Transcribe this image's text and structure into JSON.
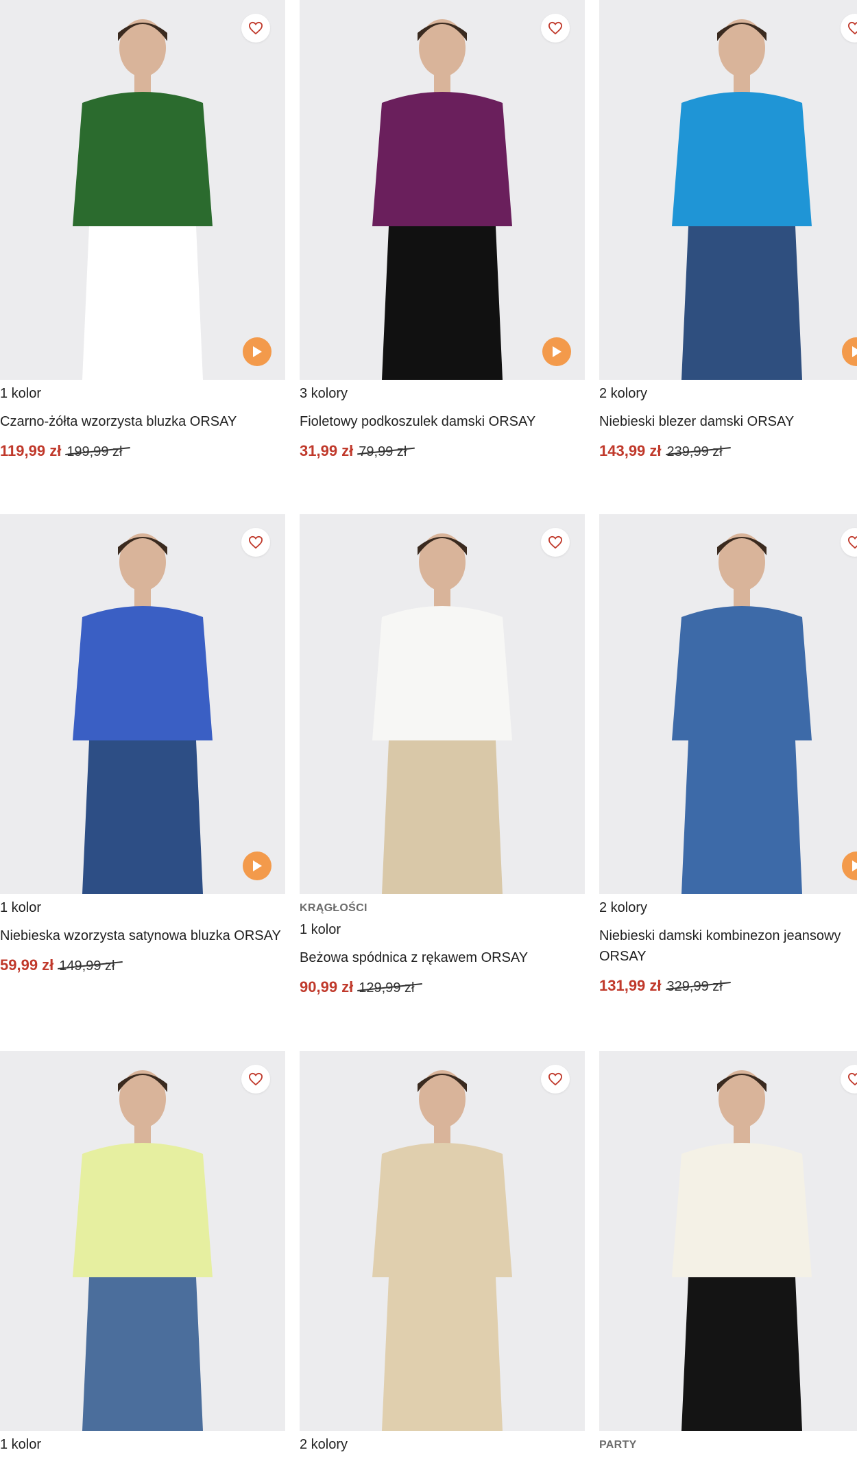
{
  "colors": {
    "price_sale": "#c0392b",
    "play_button": "#f39a4b",
    "heart_icon": "#c0392b",
    "photo_bg": "#ececee"
  },
  "products": [
    {
      "badge": "",
      "color_count": "1 kolor",
      "name": "Czarno-żółta wzorzysta bluzka ORSAY",
      "price_now": "119,99 zł",
      "price_old": "199,99 zł",
      "has_video": true,
      "garment_colors": [
        "#2b6b2e",
        "#ffffff"
      ]
    },
    {
      "badge": "",
      "color_count": "3 kolory",
      "name": "Fioletowy podkoszulek damski ORSAY",
      "price_now": "31,99 zł",
      "price_old": "79,99 zł",
      "has_video": true,
      "garment_colors": [
        "#6a1f5c",
        "#111111"
      ]
    },
    {
      "badge": "",
      "color_count": "2 kolory",
      "name": "Niebieski blezer damski ORSAY",
      "price_now": "143,99 zł",
      "price_old": "239,99 zł",
      "has_video": true,
      "garment_colors": [
        "#1f95d6",
        "#2f4f7f"
      ]
    },
    {
      "badge": "",
      "color_count": "1 kolor",
      "name": "Niebieska wzorzysta satynowa bluzka ORSAY",
      "price_now": "59,99 zł",
      "price_old": "149,99 zł",
      "has_video": true,
      "garment_colors": [
        "#3a5fc4",
        "#2d4e85"
      ]
    },
    {
      "badge": "KRĄGŁOŚCI",
      "color_count": "1 kolor",
      "name": "Beżowa spódnica z rękawem ORSAY",
      "price_now": "90,99 zł",
      "price_old": "129,99 zł",
      "has_video": false,
      "garment_colors": [
        "#f7f7f5",
        "#d9c8a8"
      ]
    },
    {
      "badge": "",
      "color_count": "2 kolory",
      "name": "Niebieski damski kombinezon jeansowy ORSAY",
      "price_now": "131,99 zł",
      "price_old": "329,99 zł",
      "has_video": true,
      "garment_colors": [
        "#3d6aa8",
        "#3d6aa8"
      ]
    },
    {
      "badge": "",
      "color_count": "1 kolor",
      "name": "",
      "price_now": "",
      "price_old": "",
      "has_video": false,
      "garment_colors": [
        "#e6efa0",
        "#4b6e9c"
      ]
    },
    {
      "badge": "",
      "color_count": "2 kolory",
      "name": "",
      "price_now": "",
      "price_old": "",
      "has_video": false,
      "garment_colors": [
        "#e0cfae",
        "#e0cfae"
      ]
    },
    {
      "badge": "PARTY",
      "color_count": "",
      "name": "",
      "price_now": "",
      "price_old": "",
      "has_video": false,
      "garment_colors": [
        "#f4f1e6",
        "#141414"
      ]
    }
  ]
}
